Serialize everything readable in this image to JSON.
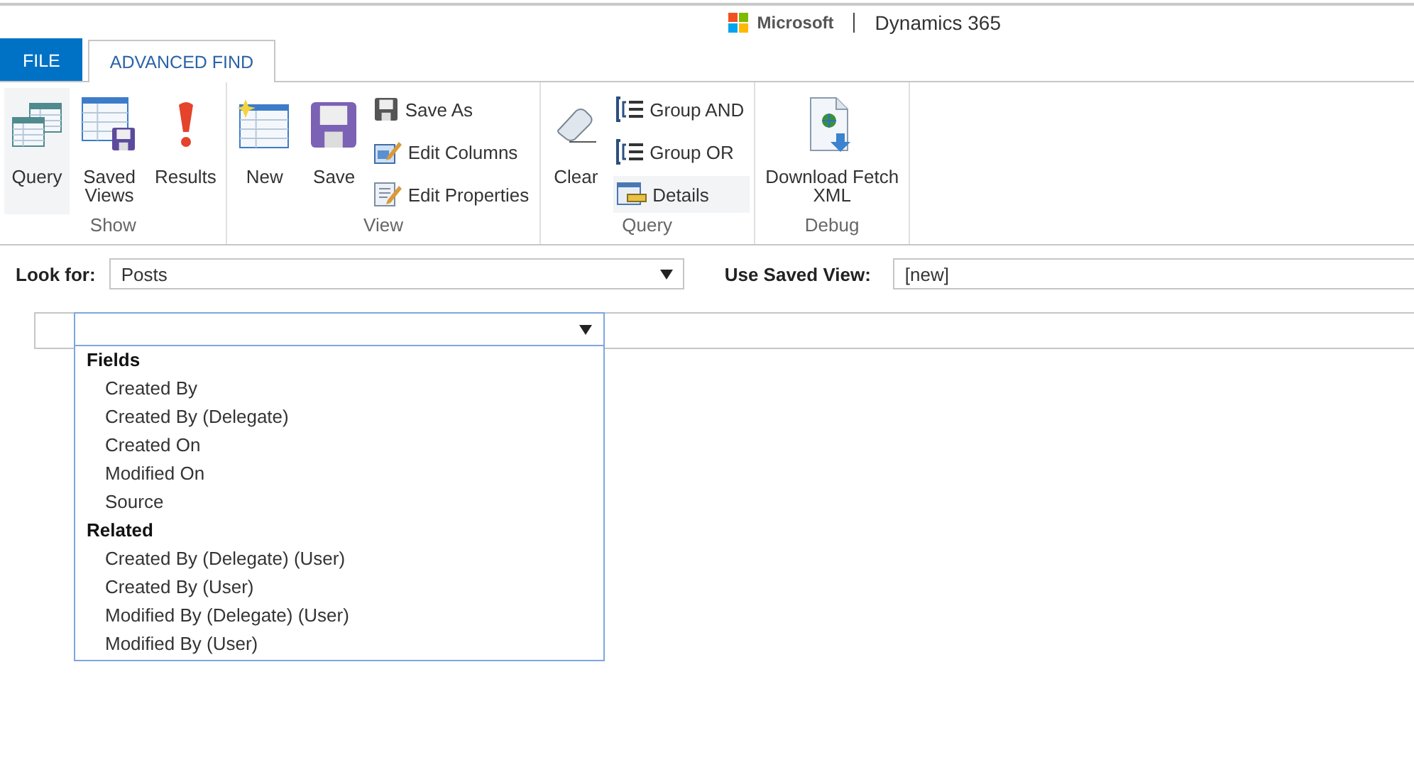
{
  "header": {
    "brand": "Microsoft",
    "product": "Dynamics 365"
  },
  "tabs": [
    {
      "label": "FILE",
      "kind": "file",
      "selected": false
    },
    {
      "label": "ADVANCED FIND",
      "kind": "tab",
      "selected": true
    }
  ],
  "ribbon": {
    "groups": [
      {
        "label": "Show",
        "items": [
          {
            "kind": "large",
            "label": "Query",
            "highlighted": true
          },
          {
            "kind": "large",
            "label": "Saved\nViews",
            "highlighted": false
          },
          {
            "kind": "large",
            "label": "Results",
            "highlighted": false
          }
        ]
      },
      {
        "label": "View",
        "items": [
          {
            "kind": "large",
            "label": "New",
            "highlighted": false
          },
          {
            "kind": "large",
            "label": "Save",
            "highlighted": false
          },
          {
            "kind": "small",
            "label": "Save As",
            "highlighted": false
          },
          {
            "kind": "small",
            "label": "Edit Columns",
            "highlighted": false
          },
          {
            "kind": "small",
            "label": "Edit Properties",
            "highlighted": false
          }
        ]
      },
      {
        "label": "Query",
        "items": [
          {
            "kind": "large",
            "label": "Clear",
            "highlighted": false
          },
          {
            "kind": "small",
            "label": "Group AND",
            "highlighted": false
          },
          {
            "kind": "small",
            "label": "Group OR",
            "highlighted": false
          },
          {
            "kind": "small",
            "label": "Details",
            "highlighted": true
          }
        ]
      },
      {
        "label": "Debug",
        "items": [
          {
            "kind": "large",
            "label": "Download Fetch\nXML",
            "highlighted": false
          }
        ]
      }
    ]
  },
  "look_for": {
    "label": "Look for:",
    "value": "Posts"
  },
  "saved_view": {
    "label": "Use Saved View:",
    "value": "[new]"
  },
  "field_dropdown": {
    "expanded": true,
    "options": [
      {
        "kind": "header",
        "label": "Fields"
      },
      {
        "kind": "option",
        "label": "Created By"
      },
      {
        "kind": "option",
        "label": "Created By (Delegate)"
      },
      {
        "kind": "option",
        "label": "Created On"
      },
      {
        "kind": "option",
        "label": "Modified On"
      },
      {
        "kind": "option",
        "label": "Source"
      },
      {
        "kind": "header",
        "label": "Related"
      },
      {
        "kind": "option",
        "label": "Created By (Delegate) (User)"
      },
      {
        "kind": "option",
        "label": "Created By (User)"
      },
      {
        "kind": "option",
        "label": "Modified By (Delegate) (User)"
      },
      {
        "kind": "option",
        "label": "Modified By (User)"
      }
    ]
  }
}
